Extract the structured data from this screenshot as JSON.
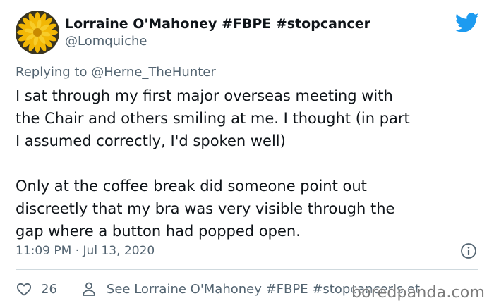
{
  "author": {
    "display_name": "Lorraine O'Mahoney #FBPE #stopcancer",
    "handle": "@Lomquiche",
    "avatar": "yellow-flower-avatar"
  },
  "reply": {
    "prefix": "Replying to",
    "mention": "@Herne_TheHunter"
  },
  "tweet": {
    "paragraph_1": "I sat through my first major overseas meeting with\nthe Chair and others smiling at me. I thought (in part\nI assumed correctly, I'd spoken well)",
    "paragraph_2": "Only at the coffee break did someone point out\ndiscreetly that my bra was very visible through the\ngap where a button had popped open.",
    "timestamp": "11:09 PM · Jul 13, 2020"
  },
  "actions": {
    "like_count": "26",
    "see_more": "See Lorraine O'Mahoney #FBPE #stopcancer's ot"
  },
  "watermark": "boredpanda.com",
  "icons": {
    "brand": "twitter-bird-icon",
    "info": "info-icon",
    "like": "heart-icon",
    "profile": "person-icon"
  },
  "colors": {
    "twitter_blue": "#1d9bf0",
    "text_primary": "#0f1419",
    "text_secondary": "#536471",
    "divider": "#cfd9de"
  }
}
